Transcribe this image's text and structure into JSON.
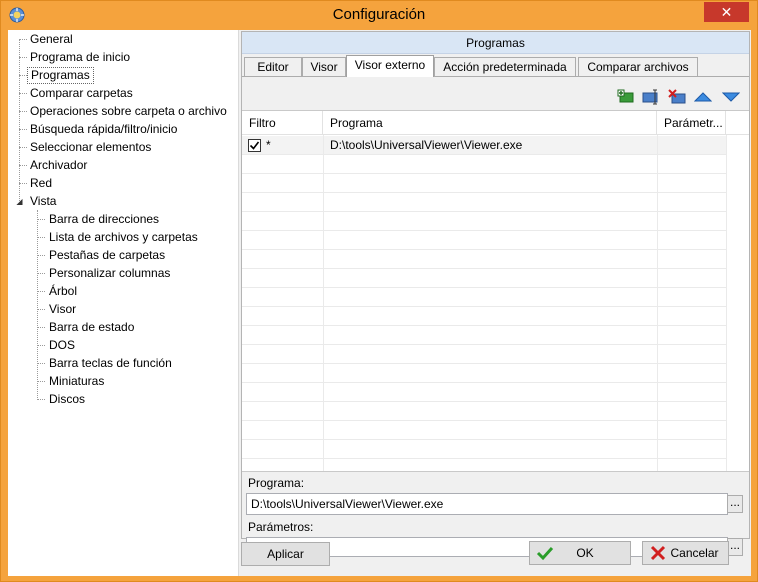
{
  "window": {
    "title": "Configuración",
    "close_label": "✕"
  },
  "tree": {
    "items": [
      {
        "label": "General"
      },
      {
        "label": "Programa de inicio"
      },
      {
        "label": "Programas"
      },
      {
        "label": "Comparar carpetas"
      },
      {
        "label": "Operaciones sobre carpeta o archivo"
      },
      {
        "label": "Búsqueda rápida/filtro/inicio"
      },
      {
        "label": "Seleccionar elementos"
      },
      {
        "label": "Archivador"
      },
      {
        "label": "Red"
      },
      {
        "label": "Vista"
      }
    ],
    "vista_children": [
      {
        "label": "Barra de direcciones"
      },
      {
        "label": "Lista de archivos y carpetas"
      },
      {
        "label": "Pestañas de carpetas"
      },
      {
        "label": "Personalizar columnas"
      },
      {
        "label": "Árbol"
      },
      {
        "label": "Visor"
      },
      {
        "label": "Barra de estado"
      },
      {
        "label": "DOS"
      },
      {
        "label": "Barra teclas de función"
      },
      {
        "label": "Miniaturas"
      },
      {
        "label": "Discos"
      }
    ],
    "expander_glyph": "◢"
  },
  "panel": {
    "header": "Programas",
    "tabs": [
      {
        "label": "Editor"
      },
      {
        "label": "Visor"
      },
      {
        "label": "Visor externo"
      },
      {
        "label": "Acción predeterminada"
      },
      {
        "label": "Comparar archivos"
      }
    ],
    "active_tab": "Visor externo"
  },
  "toolbar": {
    "icons": [
      "add-icon",
      "edit-icon",
      "delete-icon",
      "move-up-icon",
      "move-down-icon"
    ]
  },
  "grid": {
    "columns": [
      "Filtro",
      "Programa",
      "Parámetr..."
    ],
    "rows": [
      {
        "checked": true,
        "filter": "*",
        "program": "D:\\tools\\UniversalViewer\\Viewer.exe",
        "params": ""
      }
    ]
  },
  "form": {
    "program_label": "Programa:",
    "program_value": "D:\\tools\\UniversalViewer\\Viewer.exe",
    "params_label": "Parámetros:",
    "params_value": "",
    "browse_label": "..."
  },
  "buttons": {
    "apply": "Aplicar",
    "ok": "OK",
    "cancel": "Cancelar"
  },
  "colors": {
    "title_bar": "#f5a33d",
    "close_button": "#c7382b",
    "panel_header": "#d9e6f5",
    "ok_check": "#2a9d2a",
    "cancel_x": "#d11f1f"
  }
}
